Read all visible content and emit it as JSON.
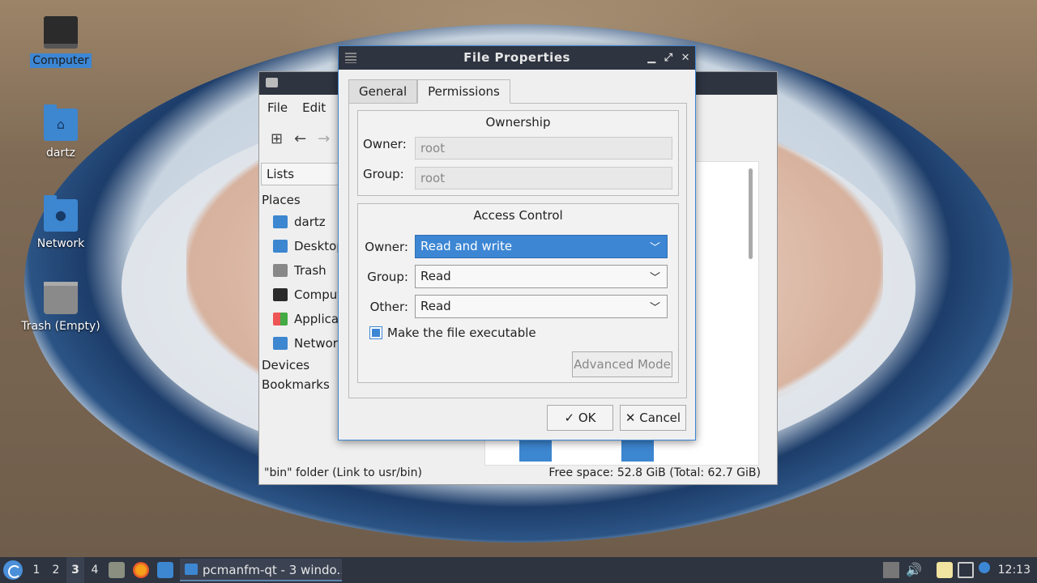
{
  "desktop": {
    "icons": [
      {
        "label": "Computer",
        "icon": "monitor-icon",
        "selected": true
      },
      {
        "label": "dartz",
        "icon": "home-folder-icon"
      },
      {
        "label": "Network",
        "icon": "network-folder-icon"
      },
      {
        "label": "Trash (Empty)",
        "icon": "trash-icon"
      }
    ]
  },
  "file_manager": {
    "menu": [
      "File",
      "Edit"
    ],
    "lists_label": "Lists",
    "places_header": "Places",
    "places": [
      "dartz",
      "Desktop",
      "Trash",
      "Computer",
      "Applications",
      "Network"
    ],
    "devices_header": "Devices",
    "bookmarks_header": "Bookmarks",
    "status_left": "\"bin\" folder (Link to usr/bin)",
    "status_right": "Free space: 52.8 GiB (Total: 62.7 GiB)"
  },
  "dialog": {
    "title": "File Properties",
    "tabs": [
      "General",
      "Permissions"
    ],
    "active_tab": "Permissions",
    "ownership": {
      "title": "Ownership",
      "owner_label": "Owner:",
      "owner_value": "root",
      "group_label": "Group:",
      "group_value": "root"
    },
    "access": {
      "title": "Access Control",
      "owner_label": "Owner:",
      "owner_value": "Read and write",
      "group_label": "Group:",
      "group_value": "Read",
      "other_label": "Other:",
      "other_value": "Read",
      "executable_label": "Make the file executable",
      "executable_checked": true,
      "advanced_label": "Advanced Mode"
    },
    "ok_label": "OK",
    "cancel_label": "Cancel",
    "ok_glyph": "✓",
    "cancel_glyph": "✕"
  },
  "taskbar": {
    "workspaces": [
      "1",
      "2",
      "3",
      "4"
    ],
    "active_workspace": "3",
    "task_label": "pcmanfm-qt - 3 windo...",
    "clock": "12:13"
  },
  "colors": {
    "accent": "#3c86d4",
    "titlebar": "#2e3440"
  }
}
